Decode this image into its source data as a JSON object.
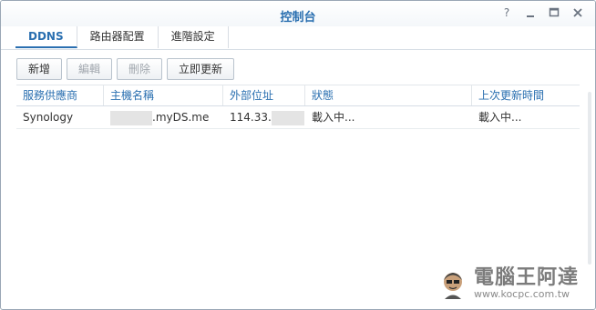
{
  "window": {
    "title": "控制台"
  },
  "tabs": [
    {
      "label": "DDNS"
    },
    {
      "label": "路由器配置"
    },
    {
      "label": "進階設定"
    }
  ],
  "toolbar": {
    "add_label": "新增",
    "edit_label": "編輯",
    "delete_label": "刪除",
    "update_label": "立即更新"
  },
  "table": {
    "columns": [
      "服務供應商",
      "主機名稱",
      "外部位址",
      "狀態",
      "上次更新時間"
    ],
    "rows": [
      {
        "provider": "Synology",
        "hostname_suffix": ".myDS.me",
        "external_prefix": "114.33.",
        "status": "載入中...",
        "last_update": "載入中..."
      }
    ]
  },
  "watermark": {
    "name": "電腦王阿達",
    "url": "www.kocpc.com.tw"
  },
  "colors": {
    "accent": "#2a6fb0",
    "border": "#d6dde5"
  }
}
